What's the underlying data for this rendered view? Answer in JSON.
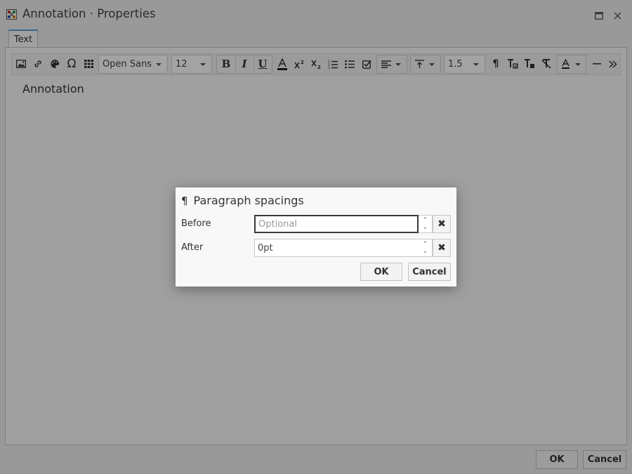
{
  "window": {
    "title": "Annotation · Properties"
  },
  "tabs": [
    {
      "label": "Text"
    }
  ],
  "toolbar": {
    "icons": [
      "image-icon",
      "link-icon",
      "palette-icon",
      "omega-icon",
      "table-icon"
    ],
    "font_family": {
      "value": "Open Sans"
    },
    "font_size": {
      "value": "12"
    },
    "bold_label": "B",
    "italic_label": "I",
    "underline_label": "U",
    "line_height": {
      "value": "1.5"
    }
  },
  "content": {
    "text": "Annotation"
  },
  "footer": {
    "ok_label": "OK",
    "cancel_label": "Cancel"
  },
  "dialog": {
    "icon": "¶",
    "title": "Paragraph spacings",
    "before": {
      "label": "Before",
      "placeholder": "Optional",
      "value": ""
    },
    "after": {
      "label": "After",
      "value": "0pt"
    },
    "clear_glyph": "✖",
    "ok_label": "OK",
    "cancel_label": "Cancel"
  },
  "colors": {
    "accent": "#5aa0d8",
    "overlay": "rgba(0,0,0,0.36)"
  }
}
